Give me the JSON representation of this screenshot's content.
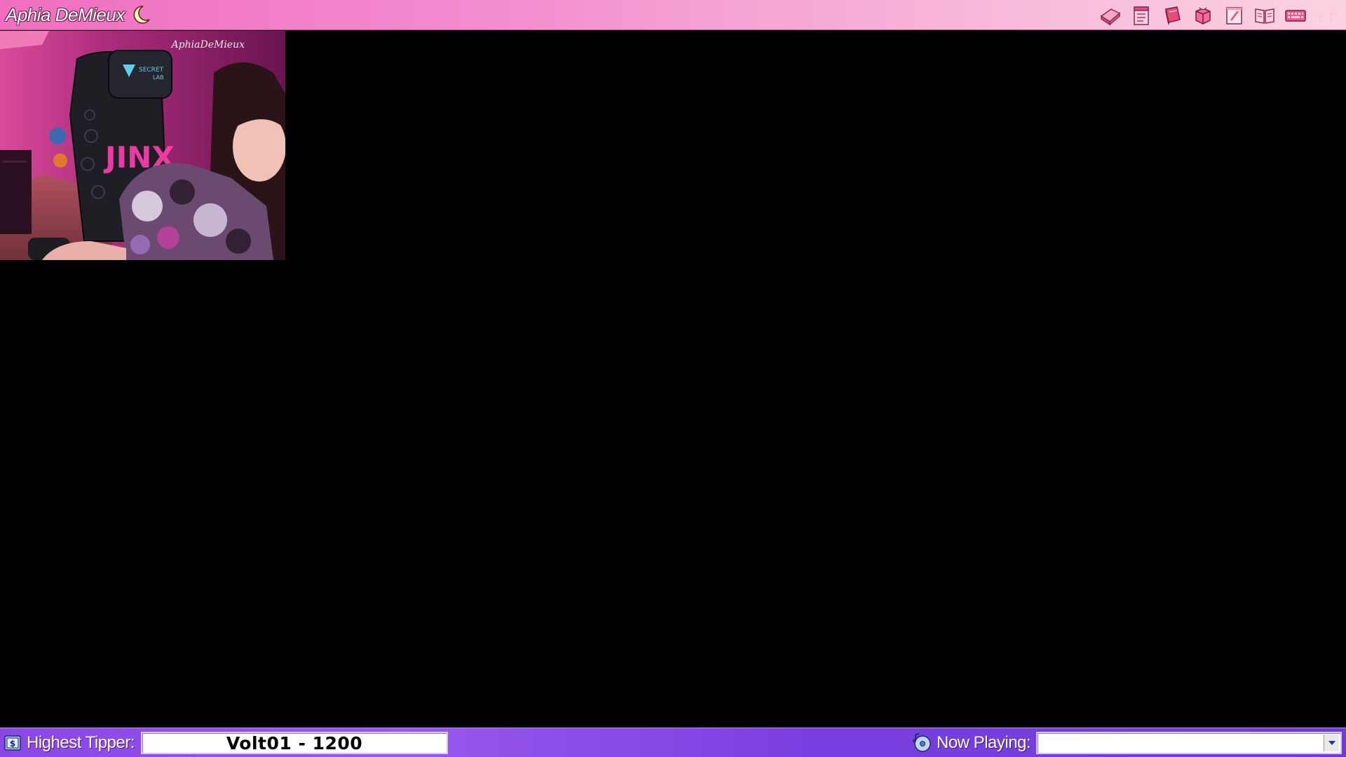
{
  "topbar": {
    "title": "Aphia DeMieux",
    "moon_icon": "crescent-moon-icon",
    "tray_icons": [
      {
        "name": "soap-icon",
        "color": "#f07aa8"
      },
      {
        "name": "notepad-icon",
        "color": "#f05a8a"
      },
      {
        "name": "book-icon",
        "color": "#e84a7a"
      },
      {
        "name": "gift-box-icon",
        "color": "#f0609a"
      },
      {
        "name": "sticky-note-icon",
        "color": "#f07aaa"
      },
      {
        "name": "open-book-icon",
        "color": "#f06aa0"
      },
      {
        "name": "keyboard-icon",
        "color": "#ee5a8a"
      },
      {
        "name": "palm-tree-icon",
        "color": "#f8c6d8"
      }
    ]
  },
  "webcam": {
    "watermark": "AphiaDeMieux"
  },
  "bottombar": {
    "highest_tipper_label": "Highest Tipper:",
    "highest_tipper_value": "Volt01 - 1200",
    "now_playing_label": "Now Playing:",
    "now_playing_value": ""
  },
  "colors": {
    "topbar_pink": "#f38bcf",
    "bottombar_purple": "#8a47e6",
    "background": "#000000"
  }
}
